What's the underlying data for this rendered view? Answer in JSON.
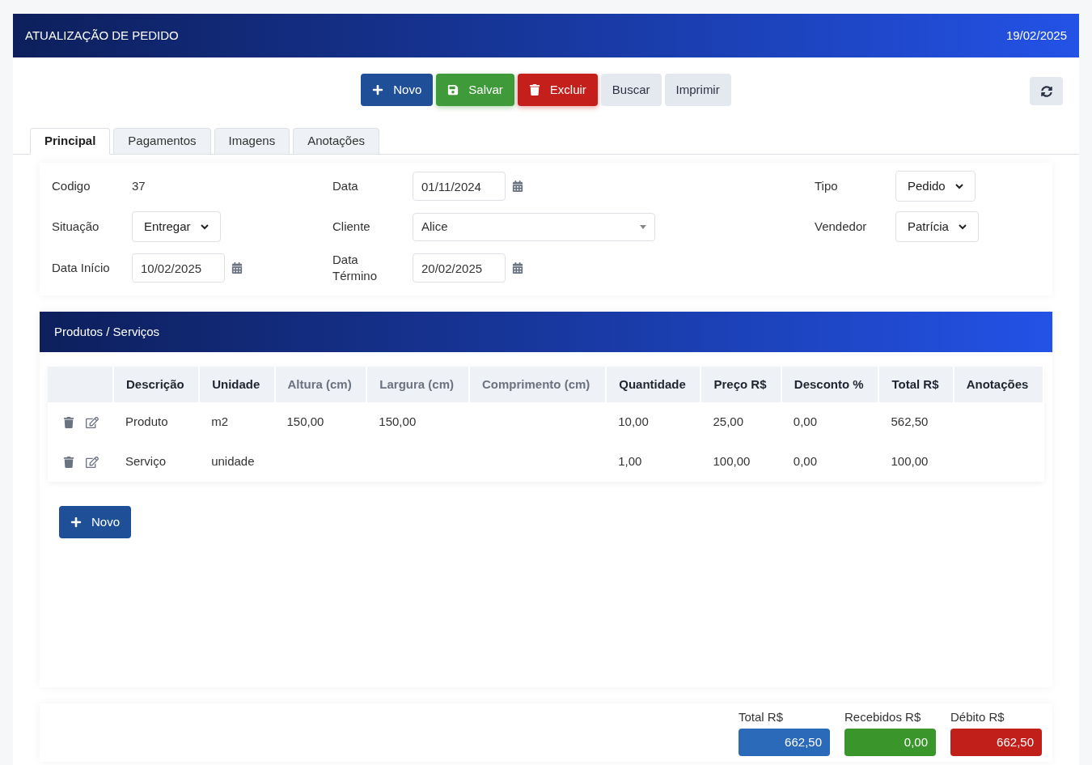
{
  "header": {
    "title": "ATUALIZAÇÃO DE PEDIDO",
    "date": "19/02/2025"
  },
  "toolbar": [
    {
      "label": "Novo",
      "kind": "primary"
    },
    {
      "label": "Salvar",
      "kind": "success"
    },
    {
      "label": "Excluir",
      "kind": "danger"
    },
    {
      "label": "Buscar",
      "kind": "light"
    },
    {
      "label": "Imprimir",
      "kind": "light"
    }
  ],
  "tabs": [
    {
      "label": "Principal",
      "selected": true
    },
    {
      "label": "Pagamentos",
      "selected": false
    },
    {
      "label": "Imagens",
      "selected": false
    },
    {
      "label": "Anotações",
      "selected": false
    }
  ],
  "form": [
    [
      {
        "label": "Codigo",
        "kind": "text",
        "value": "37"
      },
      {
        "label": "Data",
        "kind": "date",
        "value": "01/11/2024"
      },
      {
        "label": "Tipo",
        "kind": "select",
        "value": "Pedido"
      }
    ],
    [
      {
        "label": "Situação",
        "kind": "select",
        "value": "Entregar"
      },
      {
        "label": "Cliente",
        "kind": "combo",
        "value": "Alice"
      },
      {
        "label": "Vendedor",
        "kind": "select",
        "value": "Patrícia"
      }
    ],
    [
      {
        "label": "Data Início",
        "kind": "date",
        "value": "10/02/2025"
      },
      {
        "label": "Data Término",
        "kind": "date",
        "value": "20/02/2025"
      }
    ]
  ],
  "products": {
    "title": "Produtos / Serviços",
    "columns": [
      {
        "label": "Descrição",
        "muted": false
      },
      {
        "label": "Unidade",
        "muted": false
      },
      {
        "label": "Altura (cm)",
        "muted": true
      },
      {
        "label": "Largura (cm)",
        "muted": true
      },
      {
        "label": "Comprimento (cm)",
        "muted": true
      },
      {
        "label": "Quantidade",
        "muted": false
      },
      {
        "label": "Preço R$",
        "muted": false
      },
      {
        "label": "Desconto %",
        "muted": false
      },
      {
        "label": "Total R$",
        "muted": false
      },
      {
        "label": "Anotações",
        "muted": false
      }
    ],
    "rows": [
      [
        "Produto",
        "m2",
        "150,00",
        "150,00",
        "",
        "10,00",
        "25,00",
        "0,00",
        "562,50",
        ""
      ],
      [
        "Serviço",
        "unidade",
        "",
        "",
        "",
        "1,00",
        "100,00",
        "0,00",
        "100,00",
        ""
      ]
    ],
    "new_button": "Novo"
  },
  "totals": [
    {
      "label": "Total R$",
      "value": "662,50",
      "color": "#2a6ab8"
    },
    {
      "label": "Recebidos R$",
      "value": "0,00",
      "color": "#3a962b"
    },
    {
      "label": "Débito R$",
      "value": "662,50",
      "color": "#c11f1a"
    }
  ]
}
